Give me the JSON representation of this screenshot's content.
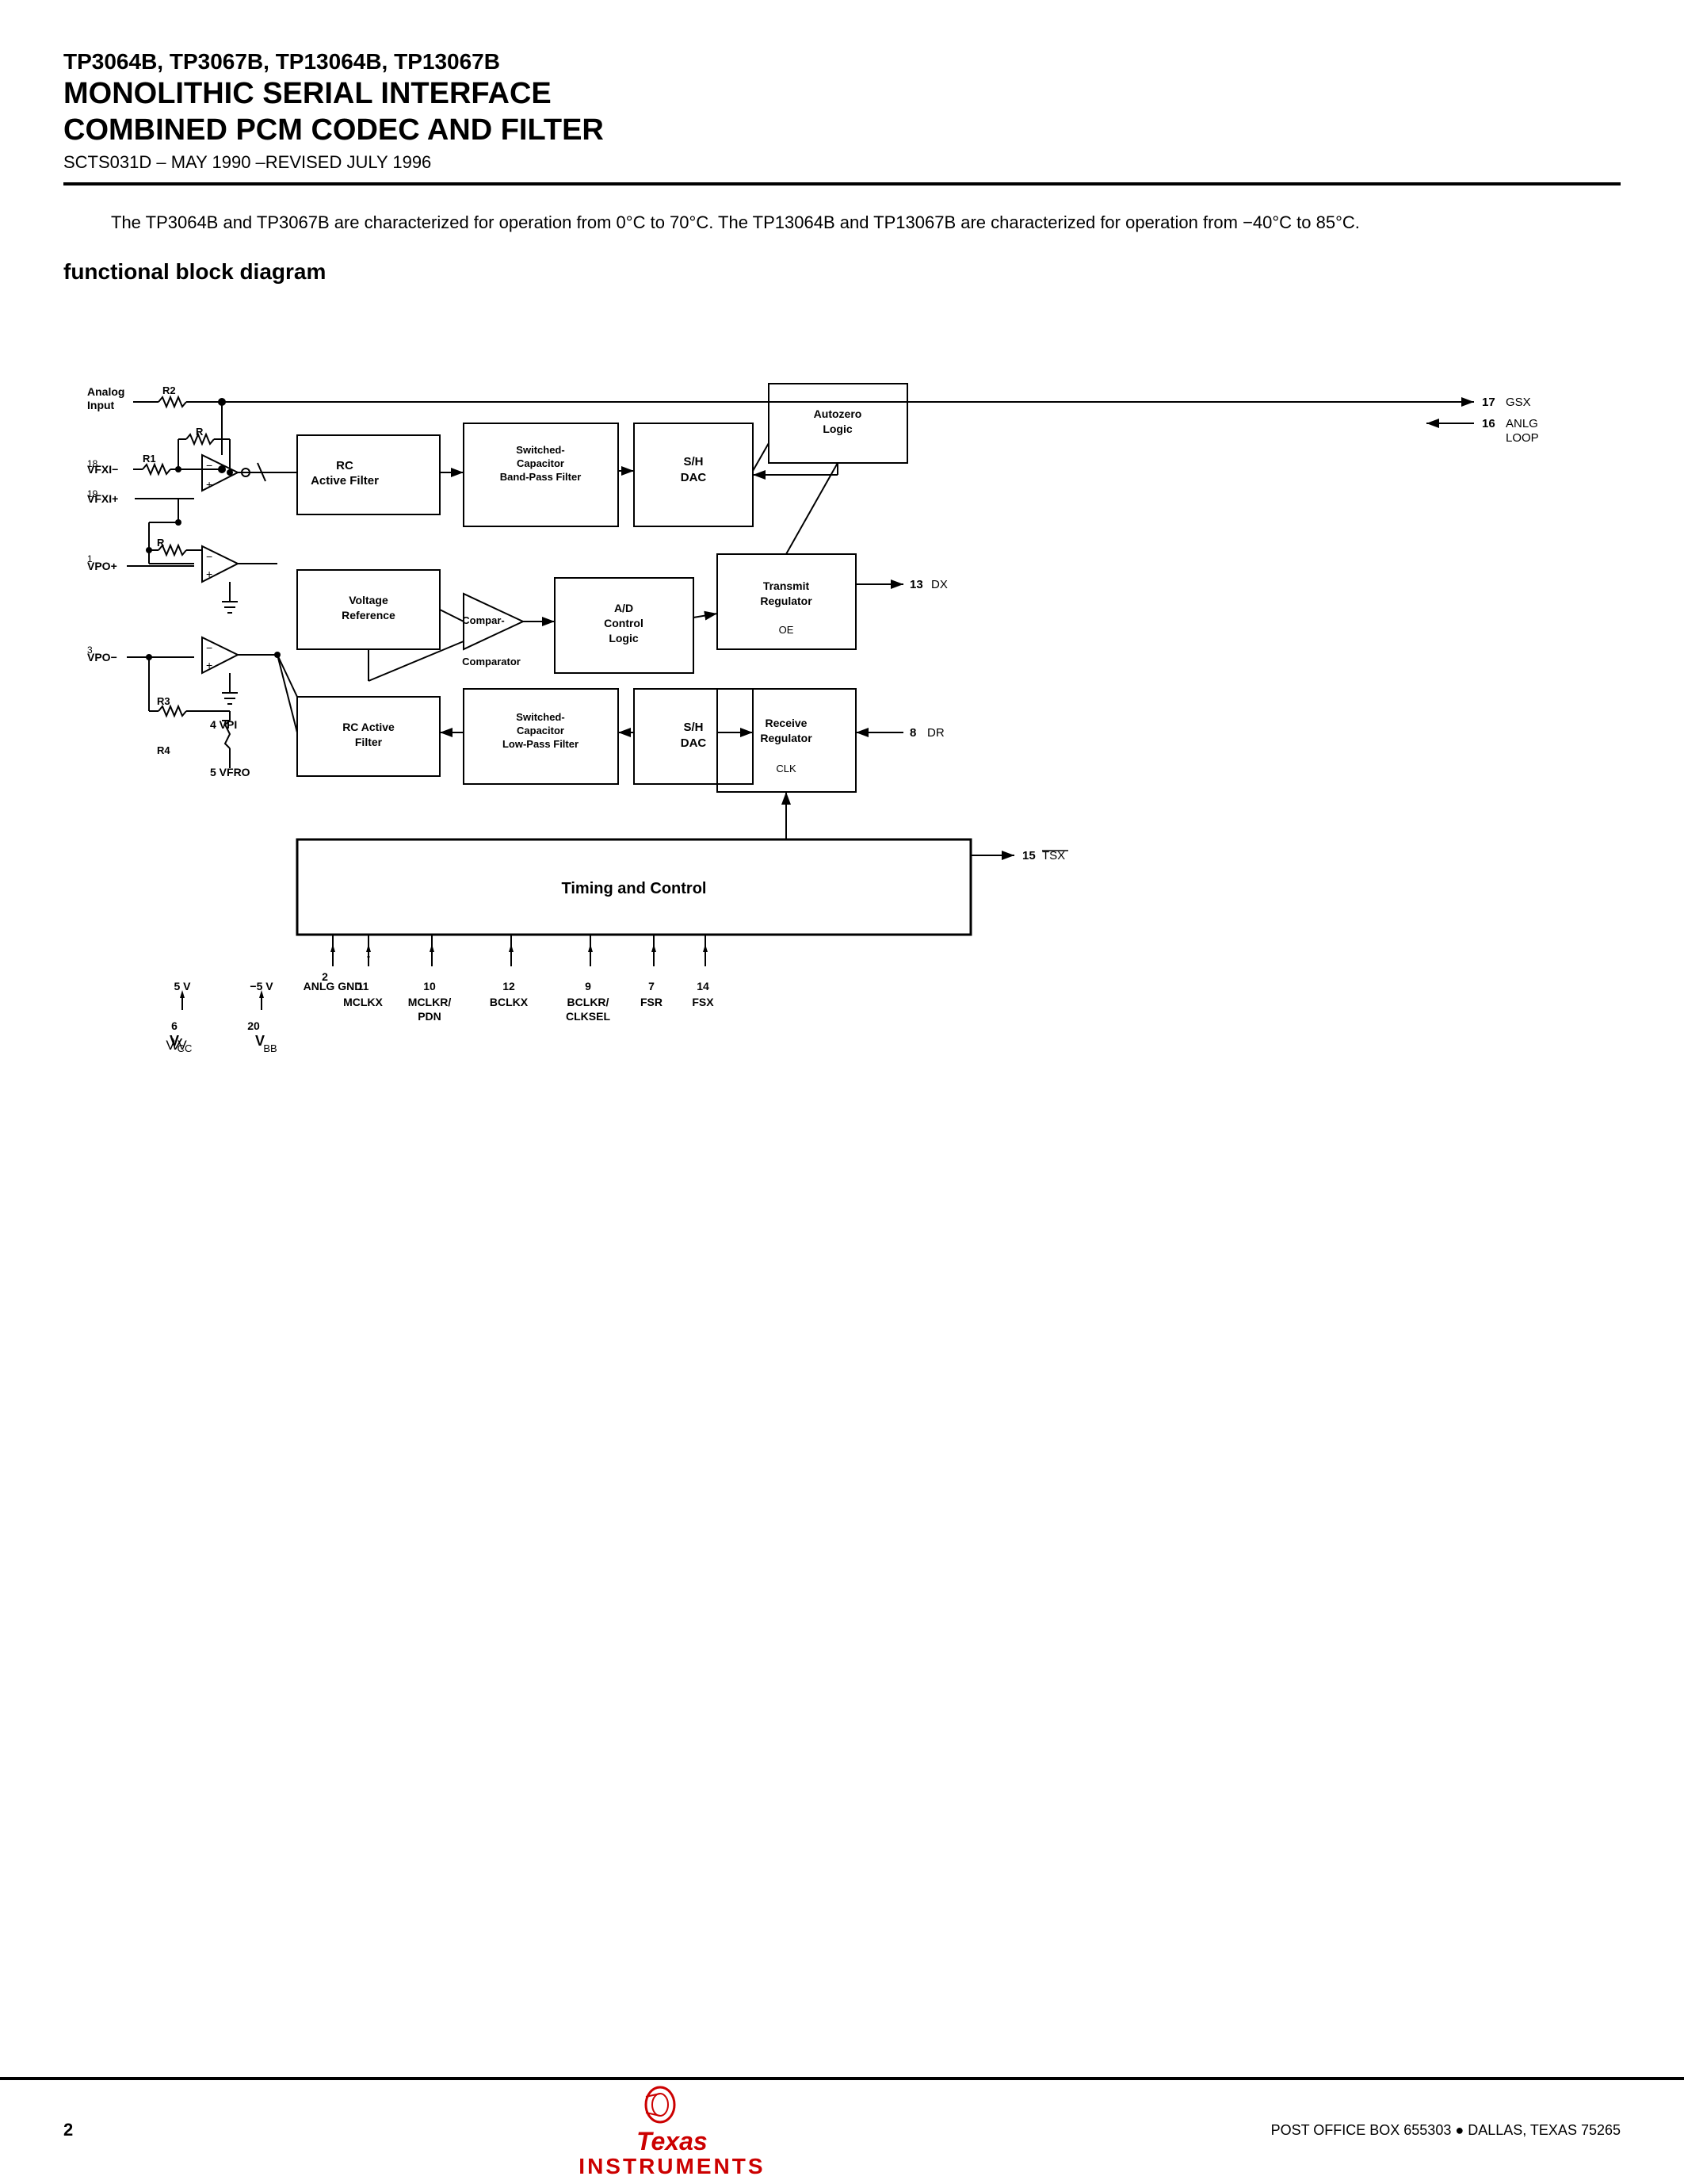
{
  "header": {
    "line1": "TP3064B, TP3067B, TP13064B, TP13067B",
    "line2": "MONOLITHIC SERIAL INTERFACE",
    "line3": "COMBINED PCM CODEC AND FILTER",
    "subtitle": "SCTS031D – MAY 1990 –REVISED JULY 1996"
  },
  "description": {
    "text": "The TP3064B and TP3067B are characterized for operation from 0°C to 70°C. The TP13064B and TP13067B are characterized for operation from −40°C to 85°C."
  },
  "section": {
    "title": "functional block diagram"
  },
  "diagram": {
    "blocks": [
      {
        "id": "rc-active-filter",
        "label": "RC\nActive Filter"
      },
      {
        "id": "sc-bpf",
        "label": "Switched-\nCapacitor\nBand-Pass Filter"
      },
      {
        "id": "sh-dac-top",
        "label": "S/H\nDAC"
      },
      {
        "id": "autozero",
        "label": "Autozero\nLogic"
      },
      {
        "id": "voltage-ref",
        "label": "Voltage\nReference"
      },
      {
        "id": "comparator",
        "label": "Comparator"
      },
      {
        "id": "ad-control",
        "label": "A/D\nControl\nLogic"
      },
      {
        "id": "transmit-reg",
        "label": "Transmit\nRegulator"
      },
      {
        "id": "rc-active-filter-bot",
        "label": "RC Active\nFilter"
      },
      {
        "id": "sc-lpf",
        "label": "Switched-\nCapacitor\nLow-Pass Filter"
      },
      {
        "id": "sh-dac-bot",
        "label": "S/H\nDAC"
      },
      {
        "id": "receive-reg",
        "label": "Receive\nRegulator"
      },
      {
        "id": "timing-control",
        "label": "Timing and Control"
      }
    ],
    "pins": [
      {
        "num": "17",
        "label": "GSX"
      },
      {
        "num": "16",
        "label": "ANLG LOOP"
      },
      {
        "num": "18",
        "label": "VFXI−"
      },
      {
        "num": "19",
        "label": "VFXI+"
      },
      {
        "num": "1",
        "label": "VPO+"
      },
      {
        "num": "3",
        "label": "VPO−"
      },
      {
        "num": "4",
        "label": "VPI"
      },
      {
        "num": "5",
        "label": "VFRO"
      },
      {
        "num": "13",
        "label": "DX"
      },
      {
        "num": "8",
        "label": "DR"
      },
      {
        "num": "15",
        "label": "TSX"
      },
      {
        "num": "6",
        "label": "VCC"
      },
      {
        "num": "20",
        "label": "VBB"
      },
      {
        "num": "2",
        "label": "ANLG GND"
      },
      {
        "num": "11",
        "label": "MCLKX"
      },
      {
        "num": "10",
        "label": "MCLKR/\nPDN"
      },
      {
        "num": "12",
        "label": "BCLKX"
      },
      {
        "num": "9",
        "label": "BCLKR/\nCLKSEL"
      },
      {
        "num": "7",
        "label": "FSR"
      },
      {
        "num": "14",
        "label": "FSX"
      }
    ],
    "power": [
      {
        "label": "5 V",
        "pin": "6",
        "name": "VCC"
      },
      {
        "label": "−5 V",
        "pin": "20",
        "name": "VBB"
      },
      {
        "label": "ANLG GND",
        "pin": "2"
      }
    ]
  },
  "footer": {
    "page": "2",
    "logo_line1": "Texas",
    "logo_line2": "INSTRUMENTS",
    "address": "POST OFFICE BOX 655303 ● DALLAS, TEXAS 75265"
  }
}
